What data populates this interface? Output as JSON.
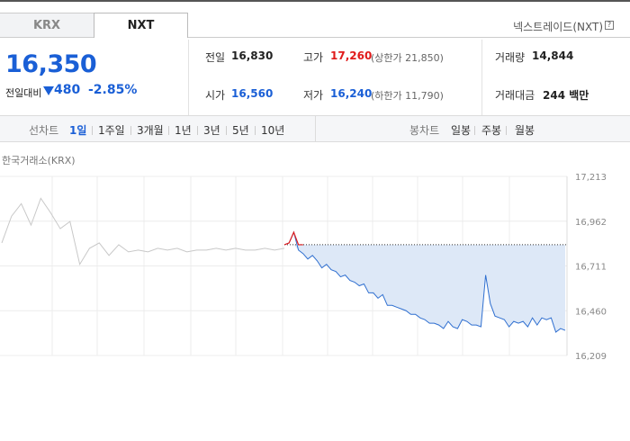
{
  "tabs": [
    {
      "label": "KRX",
      "active": false
    },
    {
      "label": "NXT",
      "active": true
    }
  ],
  "market_label": "넥스트레이드(NXT)",
  "help_icon": "?",
  "price": {
    "current": "16,350",
    "change_label": "전일대비",
    "change_direction": "down",
    "change_amount": "480",
    "change_percent": "-2.85%"
  },
  "stats": {
    "prev_close": {
      "label": "전일",
      "value": "16,830"
    },
    "high": {
      "label": "고가",
      "value": "17,260",
      "sub": "(상한가 21,850)"
    },
    "volume": {
      "label": "거래량",
      "value": "14,844"
    },
    "open": {
      "label": "시가",
      "value": "16,560"
    },
    "low": {
      "label": "저가",
      "value": "16,240",
      "sub": "(하한가 11,790)"
    },
    "amount": {
      "label": "거래대금",
      "value": "244 백만"
    }
  },
  "toolbar": {
    "line_label": "선차트",
    "line_periods": [
      "1일",
      "1주일",
      "3개월",
      "1년",
      "3년",
      "5년",
      "10년"
    ],
    "line_active": "1일",
    "candle_label": "봉차트",
    "candle_periods": [
      "일봉",
      "주봉",
      "월봉"
    ]
  },
  "chart_title": "한국거래소(KRX)",
  "colors": {
    "accent_blue": "#1a5fd6",
    "up_red": "#e01a1a",
    "nxt_line": "#2f6fd0",
    "krx_line": "#c8c8c8",
    "fill": "#dde8f7"
  },
  "chart_data": {
    "type": "line",
    "title": "",
    "xlabel": "",
    "ylabel": "",
    "ylim": [
      16209,
      17213
    ],
    "y_ticks": [
      "17,213",
      "16,962",
      "16,711",
      "16,460",
      "16,209"
    ],
    "prev_close_ref": 16830,
    "series": [
      {
        "source": "KRX",
        "values": [
          16840,
          16990,
          17060,
          16940,
          17090,
          17010,
          16920,
          16960,
          16720,
          16810,
          16840,
          16770,
          16830,
          16790,
          16800,
          16790,
          16810,
          16800,
          16810,
          16790,
          16800,
          16800,
          16810,
          16800,
          16810,
          16800,
          16800,
          16810,
          16800,
          16810
        ]
      },
      {
        "source": "NXT",
        "values": [
          16830,
          16840,
          16900,
          16800,
          16780,
          16750,
          16770,
          16740,
          16700,
          16720,
          16690,
          16680,
          16650,
          16660,
          16630,
          16620,
          16600,
          16610,
          16560,
          16560,
          16530,
          16550,
          16490,
          16490,
          16480,
          16470,
          16460,
          16440,
          16440,
          16420,
          16410,
          16390,
          16390,
          16380,
          16360,
          16400,
          16370,
          16360,
          16410,
          16400,
          16380,
          16380,
          16370,
          16660,
          16500,
          16430,
          16420,
          16410,
          16370,
          16400,
          16390,
          16400,
          16370,
          16420,
          16380,
          16420,
          16410,
          16420,
          16340,
          16360,
          16350
        ]
      }
    ]
  }
}
